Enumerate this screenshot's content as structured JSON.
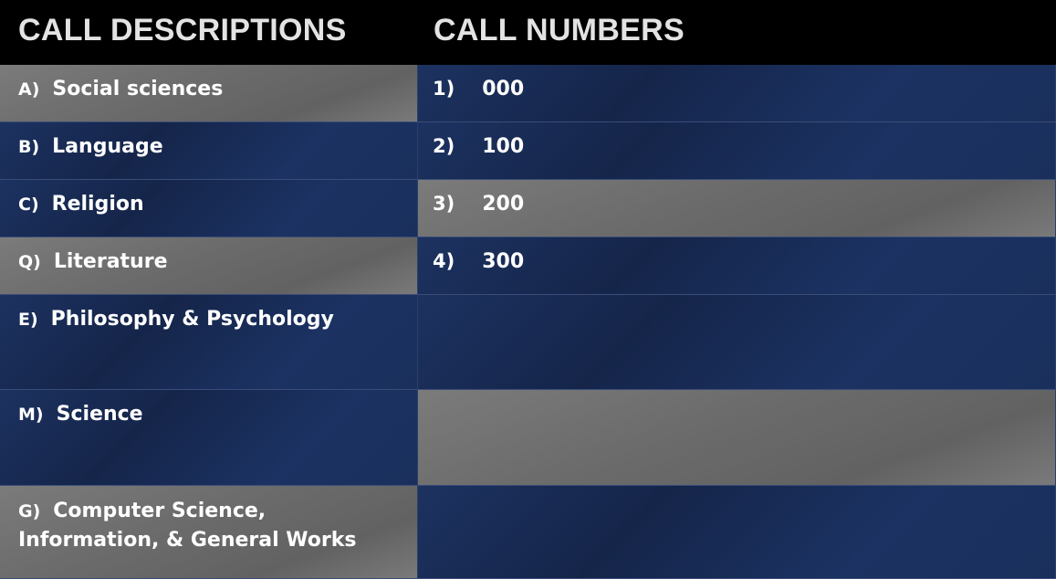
{
  "headers": {
    "descriptions": "CALL DESCRIPTIONS",
    "numbers": "CALL NUMBERS"
  },
  "descriptions": [
    {
      "key": "A)",
      "label": "Social sciences"
    },
    {
      "key": "B)",
      "label": "Language"
    },
    {
      "key": "C)",
      "label": "Religion"
    },
    {
      "key": "Q)",
      "label": "Literature"
    },
    {
      "key": "E)",
      "label": "Philosophy & Psychology"
    },
    {
      "key": "M)",
      "label": "Science"
    },
    {
      "key": "G)",
      "label": "Computer Science, Information, & General Works"
    }
  ],
  "numbers": [
    {
      "key": "1)",
      "value": "000"
    },
    {
      "key": "2)",
      "value": "100"
    },
    {
      "key": "3)",
      "value": "200"
    },
    {
      "key": "4)",
      "value": "300"
    }
  ]
}
